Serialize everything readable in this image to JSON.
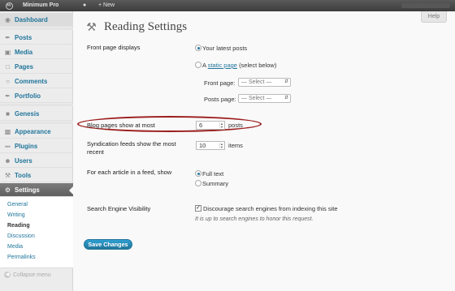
{
  "admin_bar": {
    "site_name": "Minimum Pro",
    "new_label": "+ New"
  },
  "sidebar": {
    "items": [
      {
        "label": "Dashboard",
        "icon": "dashboard-icon"
      },
      {
        "label": "Posts",
        "icon": "pin-icon"
      },
      {
        "label": "Media",
        "icon": "media-icon"
      },
      {
        "label": "Pages",
        "icon": "pages-icon"
      },
      {
        "label": "Comments",
        "icon": "comment-icon"
      },
      {
        "label": "Portfolio",
        "icon": "portfolio-icon"
      },
      {
        "label": "Genesis",
        "icon": "genesis-icon"
      },
      {
        "label": "Appearance",
        "icon": "appearance-icon"
      },
      {
        "label": "Plugins",
        "icon": "plugin-icon"
      },
      {
        "label": "Users",
        "icon": "users-icon"
      },
      {
        "label": "Tools",
        "icon": "tools-icon"
      },
      {
        "label": "Settings",
        "icon": "settings-icon"
      }
    ],
    "submenu": [
      "General",
      "Writing",
      "Reading",
      "Discussion",
      "Media",
      "Permalinks"
    ],
    "collapse_label": "Collapse menu"
  },
  "help_label": "Help",
  "page_title": "Reading Settings",
  "form": {
    "front_page_label": "Front page displays",
    "latest_posts_label": "Your latest posts",
    "static_prefix": "A",
    "static_link": "static page",
    "static_suffix": "(select below)",
    "front_page_select_label": "Front page:",
    "posts_page_select_label": "Posts page:",
    "select_placeholder": "— Select —",
    "blog_pages_label": "Blog pages show at most",
    "blog_pages_value": "6",
    "blog_pages_unit": "posts",
    "syndication_label_line1": "Syndication feeds show the most",
    "syndication_label_line2": "recent",
    "syndication_value": "10",
    "syndication_unit": "items",
    "feed_article_label": "For each article in a feed, show",
    "full_text_label": "Full text",
    "summary_label": "Summary",
    "visibility_label": "Search Engine Visibility",
    "discourage_label": "Discourage search engines from indexing this site",
    "visibility_note": "It is up to search engines to honor this request.",
    "save_label": "Save Changes"
  },
  "colors": {
    "accent": "#21759b",
    "highlight": "#9b1c1c"
  }
}
